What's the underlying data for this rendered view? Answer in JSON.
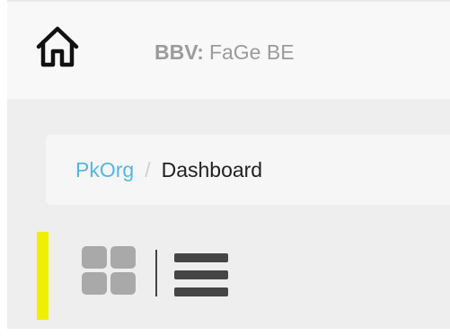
{
  "header": {
    "home_icon": "home-icon",
    "brand": "BBV:",
    "brand_name": "FaGe BE"
  },
  "breadcrumb": {
    "parent": "PkOrg",
    "separator": "/",
    "current": "Dashboard"
  },
  "view_toolbar": {
    "grid_icon": "grid-view-icon",
    "list_icon": "list-view-icon"
  },
  "colors": {
    "header_background": "#f8f8f8",
    "content_background": "#eeeeee",
    "breadcrumb_background": "#f6f6f6",
    "breadcrumb_link": "#57b7dc",
    "text_dark": "#222222",
    "muted_text": "#9b9b9b",
    "accent": "#eef000",
    "grid_icon": "#a9a9a9",
    "list_icon": "#454545"
  }
}
